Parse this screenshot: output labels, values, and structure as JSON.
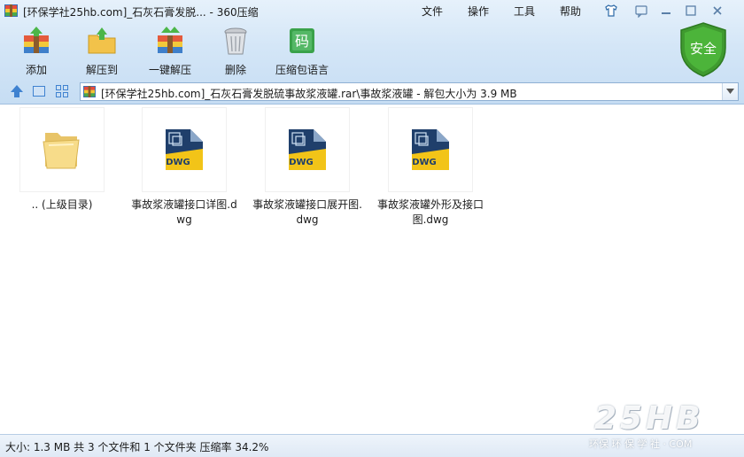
{
  "window": {
    "title": "[环保学社25hb.com]_石灰石膏发脱... - 360压缩"
  },
  "menu": [
    "文件",
    "操作",
    "工具",
    "帮助"
  ],
  "toolbar": {
    "items": [
      {
        "label": "添加",
        "icon": "add-archive-icon"
      },
      {
        "label": "解压到",
        "icon": "extract-to-icon"
      },
      {
        "label": "一键解压",
        "icon": "one-click-extract-icon"
      },
      {
        "label": "删除",
        "icon": "delete-trash-icon"
      },
      {
        "label": "压缩包语言",
        "icon": "archive-language-icon"
      }
    ],
    "language_glyph": "码"
  },
  "security_badge": {
    "label": "安全"
  },
  "address": {
    "path": "[环保学社25hb.com]_石灰石膏发脱硫事故浆液罐.rar\\事故浆液罐 - 解包大小为 3.9 MB"
  },
  "files": [
    {
      "name": ".. (上级目录)",
      "type": "folder"
    },
    {
      "name": "事故浆液罐接口详图.dwg",
      "type": "dwg"
    },
    {
      "name": "事故浆液罐接口展开图.dwg",
      "type": "dwg"
    },
    {
      "name": "事故浆液罐外形及接口图.dwg",
      "type": "dwg"
    }
  ],
  "dwg_badge": "DWG",
  "status": {
    "text": "大小: 1.3 MB 共 3 个文件和 1 个文件夹 压缩率 34.2%"
  },
  "watermark": {
    "big": "25HB",
    "small": "环保 环 保 学 社 · COM"
  },
  "colors": {
    "chrome_top": "#e6f1fb",
    "chrome_bottom": "#c6ddf3",
    "shield_green": "#3f9a2f",
    "dwg_yellow": "#f2c418",
    "dwg_blue": "#1f3f6b"
  }
}
